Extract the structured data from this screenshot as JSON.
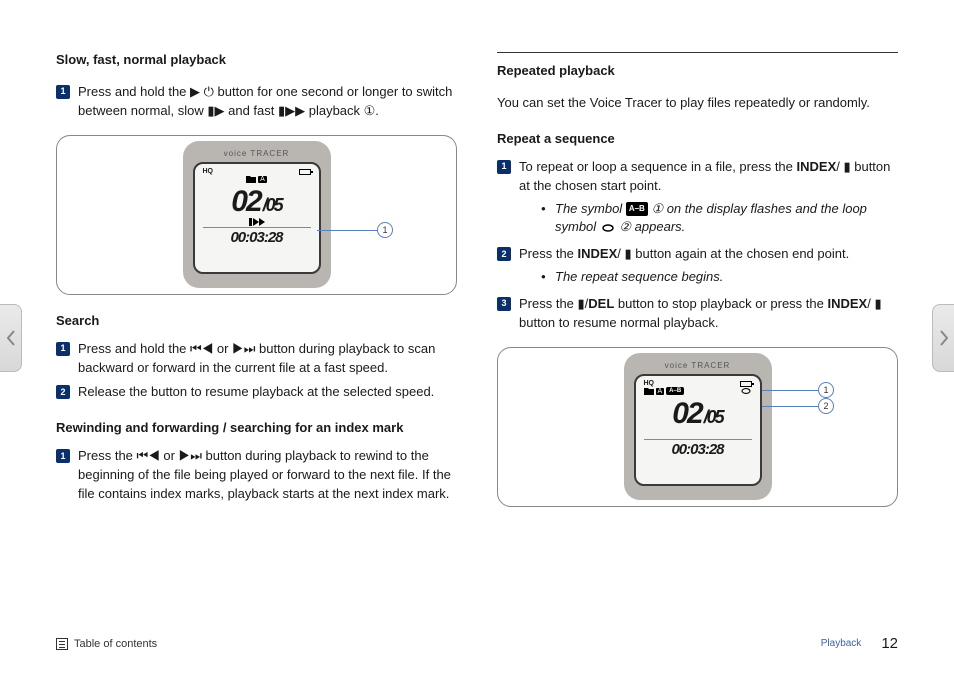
{
  "page": {
    "number": "12",
    "section": "Playback",
    "toc_label": "Table of contents"
  },
  "left": {
    "h1": "Slow, fast, normal playback",
    "step1": "Press and hold the ▶ ⏻ button for one second or longer to switch between normal, slow ▮▶ and fast ▮▶▶ playback ①.",
    "h2": "Search",
    "search_step1": "Press and hold the ⏮◀ or ▶⏭ button during playback to scan backward or forward in the current file at a fast speed.",
    "search_step2": "Release the button to resume playback at the selected speed.",
    "h3": "Rewinding and forwarding / searching for an index mark",
    "rewind_step1": "Press the ⏮◀ or ▶⏭ button during playback to rewind to the beginning of the file being played or forward to the next file. If the file contains index marks, playback starts at the next index mark."
  },
  "right": {
    "h1": "Repeated playback",
    "intro": "You can set the Voice Tracer to play files repeatedly or randomly.",
    "h2": "Repeat a sequence",
    "step1_pre": "To repeat or loop a sequence in a file, press the ",
    "step1_bold": "INDEX",
    "step1_post": "/ ▮ button at the chosen start point.",
    "note1_pre": "The symbol ",
    "note1_badge": "A–B",
    "note1_mid": " ① on the display flashes and the loop symbol ",
    "note1_post": " ② appears.",
    "step2_pre": "Press the ",
    "step2_bold": "INDEX",
    "step2_post": "/ ▮ button again at the chosen end point.",
    "note2": "The repeat sequence begins.",
    "step3_pre": "Press the ▮/",
    "step3_bold1": "DEL",
    "step3_mid": " button to stop playback or press the ",
    "step3_bold2": "INDEX",
    "step3_post": "/ ▮ button to resume normal playback."
  },
  "device": {
    "brand": "voice TRACER",
    "hq": "HQ",
    "folder": "A",
    "track": "02",
    "total": "/05",
    "time": "00:03:28",
    "callout1": "1",
    "callout2": "2"
  }
}
